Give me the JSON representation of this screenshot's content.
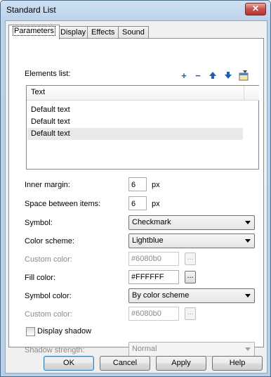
{
  "window": {
    "title": "Standard List"
  },
  "tabs": [
    "Parameters",
    "Display",
    "Effects",
    "Sound"
  ],
  "elements": {
    "label": "Elements list:",
    "column_header": "Text",
    "items": [
      "Default text",
      "Default text",
      "Default text"
    ]
  },
  "inner_margin": {
    "label": "Inner margin:",
    "value": "6",
    "unit": "px"
  },
  "space_between": {
    "label": "Space between items:",
    "value": "6",
    "unit": "px"
  },
  "symbol": {
    "label": "Symbol:",
    "value": "Checkmark"
  },
  "color_scheme": {
    "label": "Color scheme:",
    "value": "Lightblue"
  },
  "custom_color_1": {
    "label": "Custom color:",
    "value": "#6080b0",
    "button": "..."
  },
  "fill_color": {
    "label": "Fill color:",
    "value": "#FFFFFF",
    "button": "..."
  },
  "symbol_color": {
    "label": "Symbol color:",
    "value": "By color scheme"
  },
  "custom_color_2": {
    "label": "Custom color:",
    "value": "#6080b0",
    "button": "..."
  },
  "display_shadow": {
    "label": "Display shadow",
    "checked": false
  },
  "shadow_strength": {
    "label": "Shadow strength:",
    "value": "Normal"
  },
  "buttons": {
    "ok": "OK",
    "cancel": "Cancel",
    "apply": "Apply",
    "help": "Help"
  },
  "icons": {
    "close": "close-icon",
    "add": "add-icon",
    "remove": "remove-icon",
    "up": "move-up-icon",
    "down": "move-down-icon",
    "properties": "properties-icon"
  },
  "colors": {
    "accent": "#1e5fb4",
    "title_gradient": "#bcd2ea"
  }
}
